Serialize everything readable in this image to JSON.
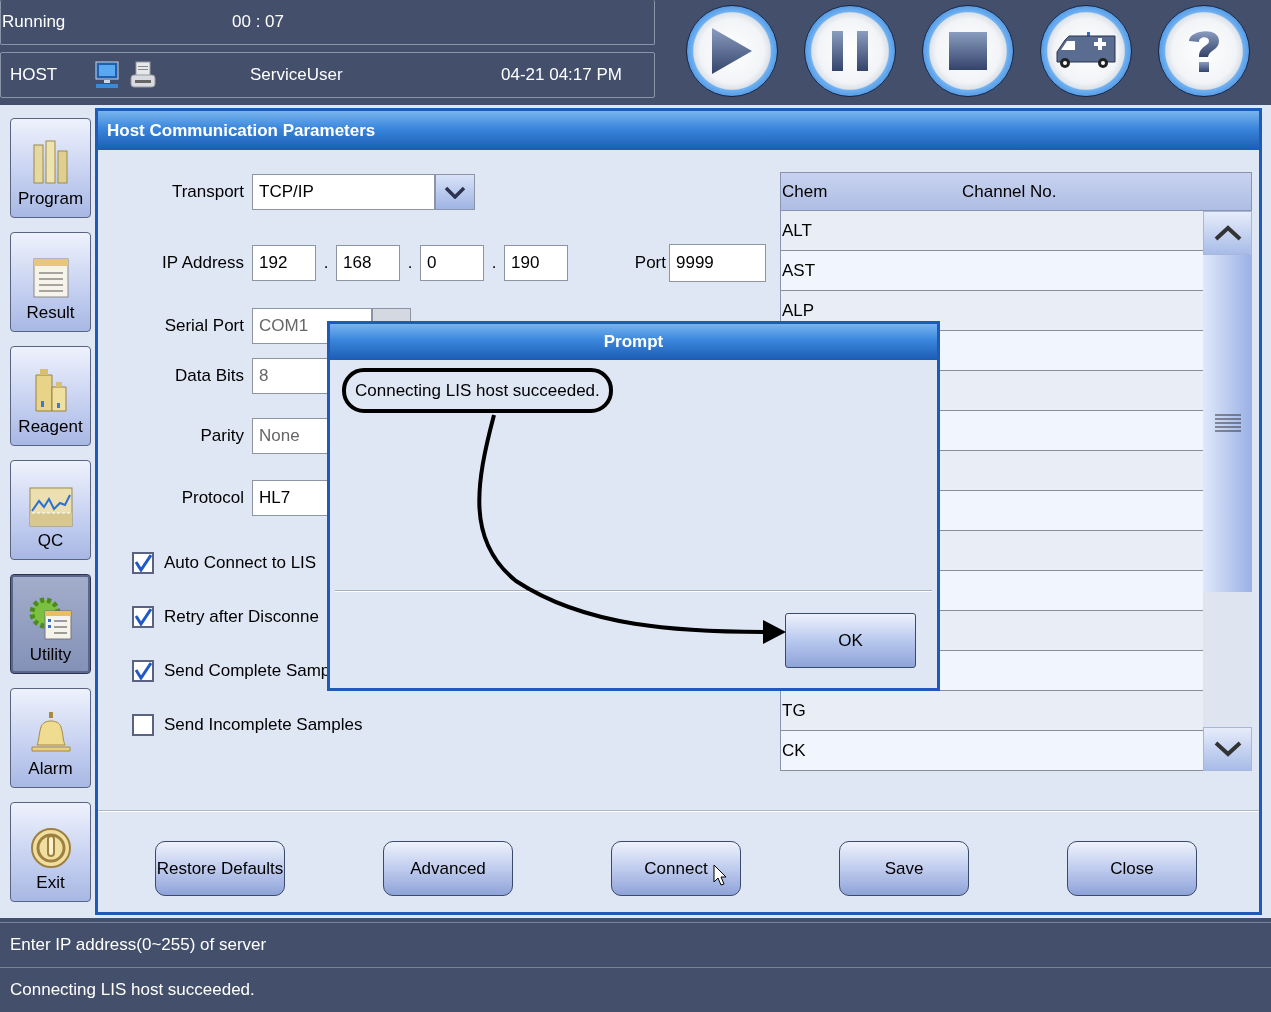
{
  "status": {
    "state": "Running",
    "elapsed": "00 : 07",
    "mode": "HOST",
    "user": "ServiceUser",
    "datetime": "04-21 04:17 PM"
  },
  "toolbar": [
    {
      "kind": "play"
    },
    {
      "kind": "pause"
    },
    {
      "kind": "stop"
    },
    {
      "kind": "emergency"
    },
    {
      "kind": "help"
    }
  ],
  "sidebar": {
    "items": [
      {
        "kind": "program",
        "label": "Program",
        "selected": false
      },
      {
        "kind": "result",
        "label": "Result",
        "selected": false
      },
      {
        "kind": "reagent",
        "label": "Reagent",
        "selected": false
      },
      {
        "kind": "qc",
        "label": "QC",
        "selected": false
      },
      {
        "kind": "utility",
        "label": "Utility",
        "selected": true
      },
      {
        "kind": "alarm",
        "label": "Alarm",
        "selected": false
      },
      {
        "kind": "exit",
        "label": "Exit",
        "selected": false
      }
    ]
  },
  "panel": {
    "title": "Host Communication Parameters",
    "fields": [
      {
        "kind": "dropdown",
        "label": "Transport",
        "value": "TCP/IP",
        "disabled": false
      },
      {
        "kind": "ip",
        "label": "IP Address",
        "octets": [
          "192",
          "168",
          "0",
          "190"
        ],
        "separators": [
          ".",
          ".",
          "."
        ],
        "port_label": "Port",
        "port": "9999"
      },
      {
        "kind": "dropdown",
        "label": "Serial Port",
        "value": "COM1",
        "disabled": true
      },
      {
        "kind": "text",
        "label": "Data Bits",
        "value": "8",
        "disabled": true
      },
      {
        "kind": "text",
        "label": "Parity",
        "value": "None",
        "disabled": true
      },
      {
        "kind": "text",
        "label": "Protocol",
        "value": "HL7",
        "disabled": false
      }
    ],
    "checkboxes": [
      {
        "label": "Auto Connect to LIS",
        "checked": true
      },
      {
        "label": "Retry after Disconne",
        "checked": true
      },
      {
        "label": "Send Complete Samp",
        "checked": true
      },
      {
        "label": "Send Incomplete Samples",
        "checked": false
      }
    ],
    "table": {
      "columns": [
        "Chem",
        "Channel No."
      ],
      "rows": [
        {
          "chem": "ALT"
        },
        {
          "chem": "AST"
        },
        {
          "chem": "ALP"
        },
        {},
        {},
        {},
        {},
        {},
        {},
        {},
        {},
        {},
        {
          "chem": "TG"
        },
        {
          "chem": "CK"
        }
      ]
    },
    "buttons": [
      "Restore Defaults",
      "Advanced",
      "Connect",
      "Save",
      "Close"
    ]
  },
  "dialog": {
    "title": "Prompt",
    "message": "Connecting LIS host succeeded.",
    "button": "OK"
  },
  "status_bar": [
    "Enter IP address(0~255) of server",
    "Connecting LIS host succeeded."
  ]
}
